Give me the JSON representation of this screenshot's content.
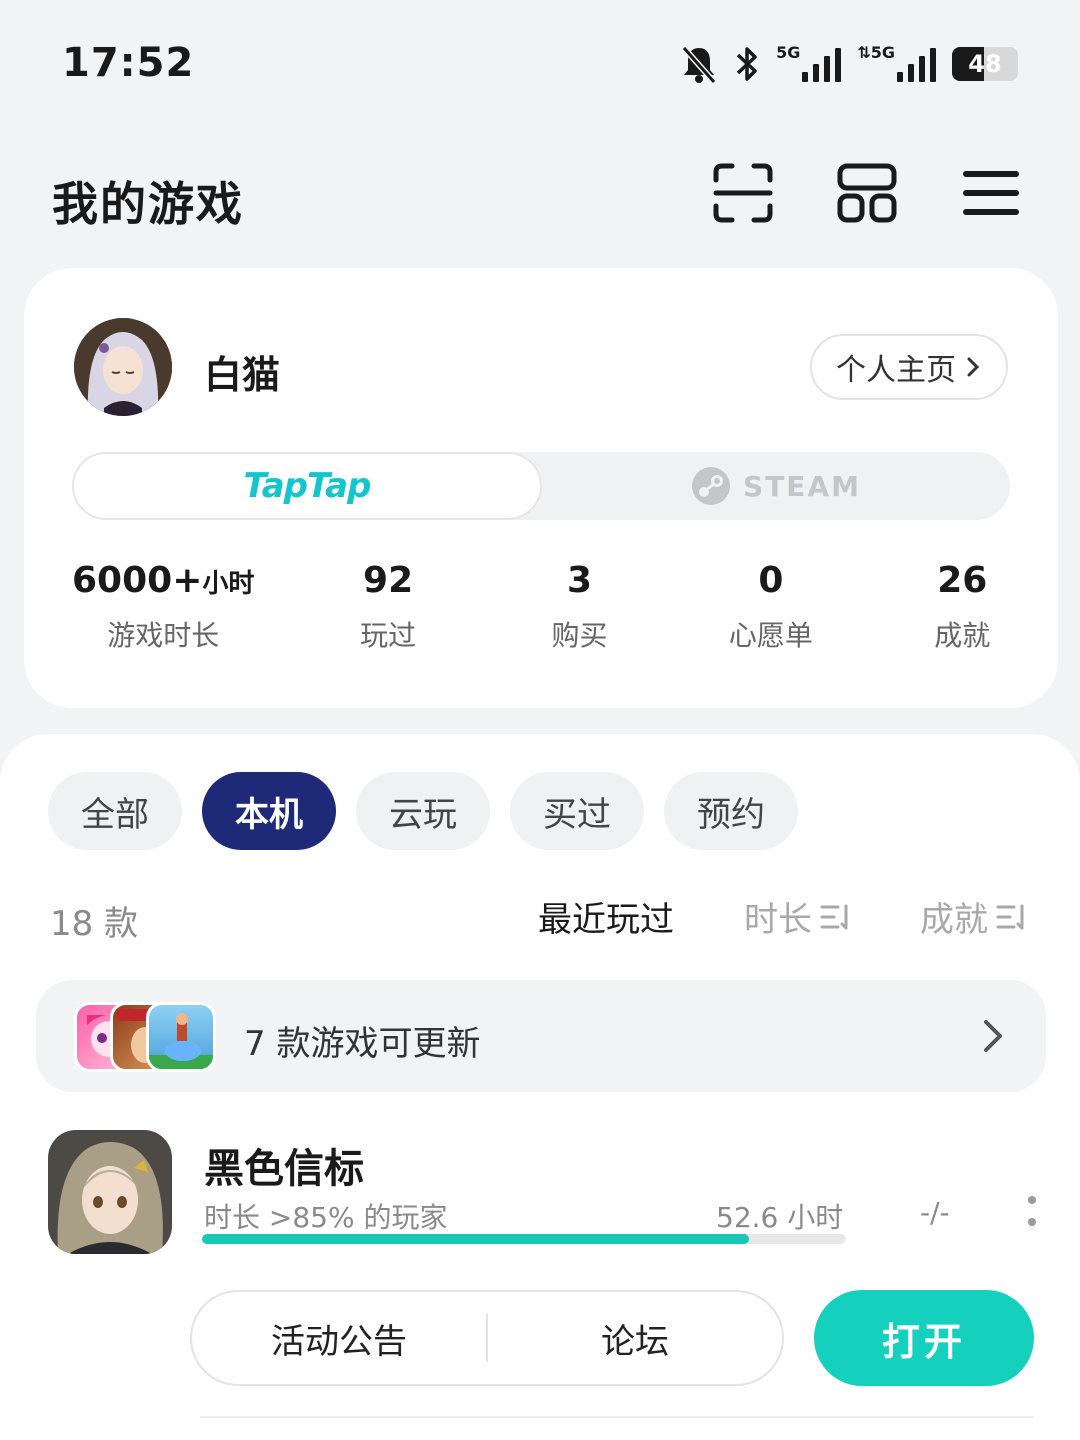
{
  "status_bar": {
    "time": "17:52",
    "net1": "5G",
    "net2": "5G",
    "battery": "48",
    "icons": [
      "bell-muted-icon",
      "bluetooth-icon",
      "signal-icon",
      "signal-icon",
      "battery-icon"
    ]
  },
  "header": {
    "title": "我的游戏",
    "icons": [
      "scan-icon",
      "grid-icon",
      "menu-icon"
    ]
  },
  "profile": {
    "username": "白猫",
    "home_button": "个人主页",
    "platforms": {
      "taptap": "TapTap",
      "steam": "STEAM",
      "active": "taptap"
    },
    "stats": [
      {
        "value": "6000+",
        "unit": "小时",
        "label": "游戏时长"
      },
      {
        "value": "92",
        "unit": "",
        "label": "玩过"
      },
      {
        "value": "3",
        "unit": "",
        "label": "购买"
      },
      {
        "value": "0",
        "unit": "",
        "label": "心愿单"
      },
      {
        "value": "26",
        "unit": "",
        "label": "成就"
      }
    ]
  },
  "filters": {
    "chips": [
      "全部",
      "本机",
      "云玩",
      "买过",
      "预约"
    ],
    "active": "本机",
    "count": "18 款",
    "sort": [
      "最近玩过",
      "时长",
      "成就"
    ],
    "sort_active": "最近玩过"
  },
  "update_banner": {
    "text": "7 款游戏可更新"
  },
  "games": [
    {
      "name": "黑色信标",
      "rank_text": "时长 >85% 的玩家",
      "hours": "52.6 小时",
      "achievements": "-/-",
      "progress": 0.85,
      "actions": [
        "活动公告",
        "论坛"
      ],
      "open_label": "打开"
    }
  ],
  "colors": {
    "accent": "#15d0bd",
    "chip_active": "#1e2a78",
    "taptap": "#15c5ce"
  }
}
